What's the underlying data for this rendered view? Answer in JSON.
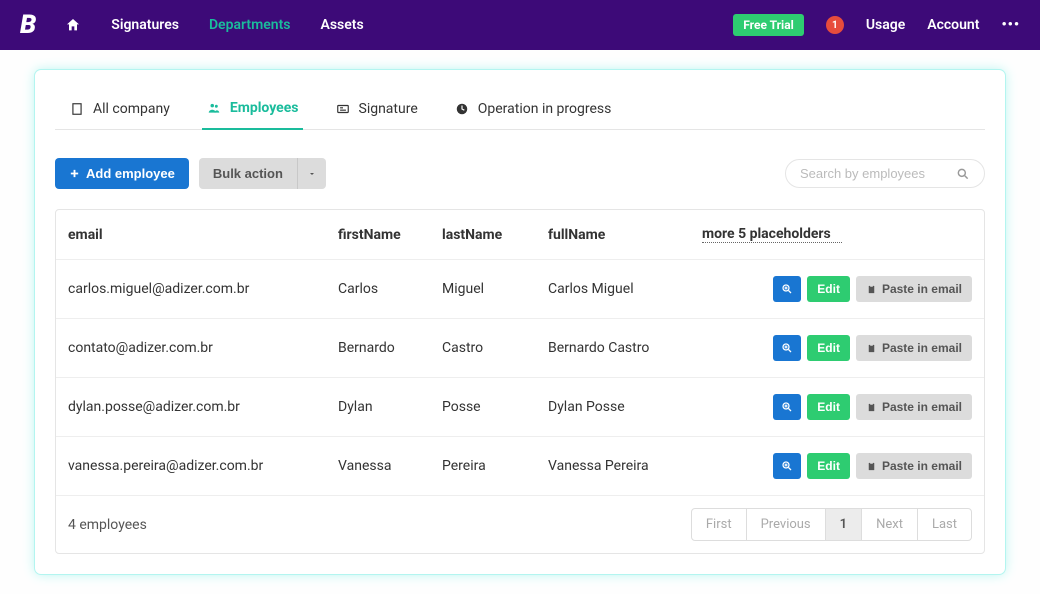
{
  "header": {
    "logo": "B",
    "nav": {
      "signatures": "Signatures",
      "departments": "Departments",
      "assets": "Assets"
    },
    "free_trial": "Free Trial",
    "badge_count": "1",
    "usage": "Usage",
    "account": "Account",
    "ellipsis": "•••"
  },
  "tabs": {
    "all_company": "All company",
    "employees": "Employees",
    "signature": "Signature",
    "operation": "Operation in progress"
  },
  "toolbar": {
    "add_employee": "Add employee",
    "bulk_action": "Bulk action"
  },
  "search": {
    "placeholder": "Search by employees"
  },
  "columns": {
    "email": "email",
    "firstName": "firstName",
    "lastName": "lastName",
    "fullName": "fullName",
    "more": "more 5 placeholders"
  },
  "row_actions": {
    "edit": "Edit",
    "paste": "Paste in email"
  },
  "rows": [
    {
      "email": "carlos.miguel@adizer.com.br",
      "firstName": "Carlos",
      "lastName": "Miguel",
      "fullName": "Carlos Miguel"
    },
    {
      "email": "contato@adizer.com.br",
      "firstName": "Bernardo",
      "lastName": "Castro",
      "fullName": "Bernardo Castro"
    },
    {
      "email": "dylan.posse@adizer.com.br",
      "firstName": "Dylan",
      "lastName": "Posse",
      "fullName": "Dylan Posse"
    },
    {
      "email": "vanessa.pereira@adizer.com.br",
      "firstName": "Vanessa",
      "lastName": "Pereira",
      "fullName": "Vanessa Pereira"
    }
  ],
  "footer": {
    "count_text": "4 employees"
  },
  "pager": {
    "first": "First",
    "previous": "Previous",
    "page": "1",
    "next": "Next",
    "last": "Last"
  }
}
